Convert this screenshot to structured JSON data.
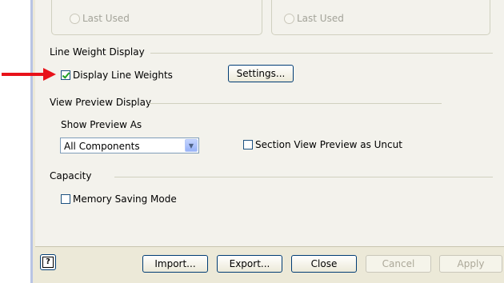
{
  "top_radios": [
    {
      "label": "Last Used"
    },
    {
      "label": "Last Used"
    }
  ],
  "line_weight": {
    "heading": "Line Weight Display",
    "display_checkbox": {
      "label": "Display Line Weights",
      "checked": true
    },
    "settings_button": "Settings..."
  },
  "view_preview": {
    "heading": "View Preview Display",
    "show_preview_label": "Show Preview As",
    "combo_value": "All Components",
    "section_checkbox": {
      "label": "Section View Preview as Uncut",
      "checked": false
    }
  },
  "capacity": {
    "heading": "Capacity",
    "memory_checkbox": {
      "label": "Memory Saving Mode",
      "checked": false
    }
  },
  "footer": {
    "help_label": "?",
    "import": "Import...",
    "export": "Export...",
    "close": "Close",
    "cancel": "Cancel",
    "apply": "Apply"
  },
  "colors": {
    "annotation_arrow": "#e8121a",
    "dialog_bg": "#ece9d8",
    "check_green": "#21a121"
  },
  "icons": {
    "annotation": "red-arrow-icon",
    "combo": "chevron-down-icon",
    "help": "help-icon"
  }
}
